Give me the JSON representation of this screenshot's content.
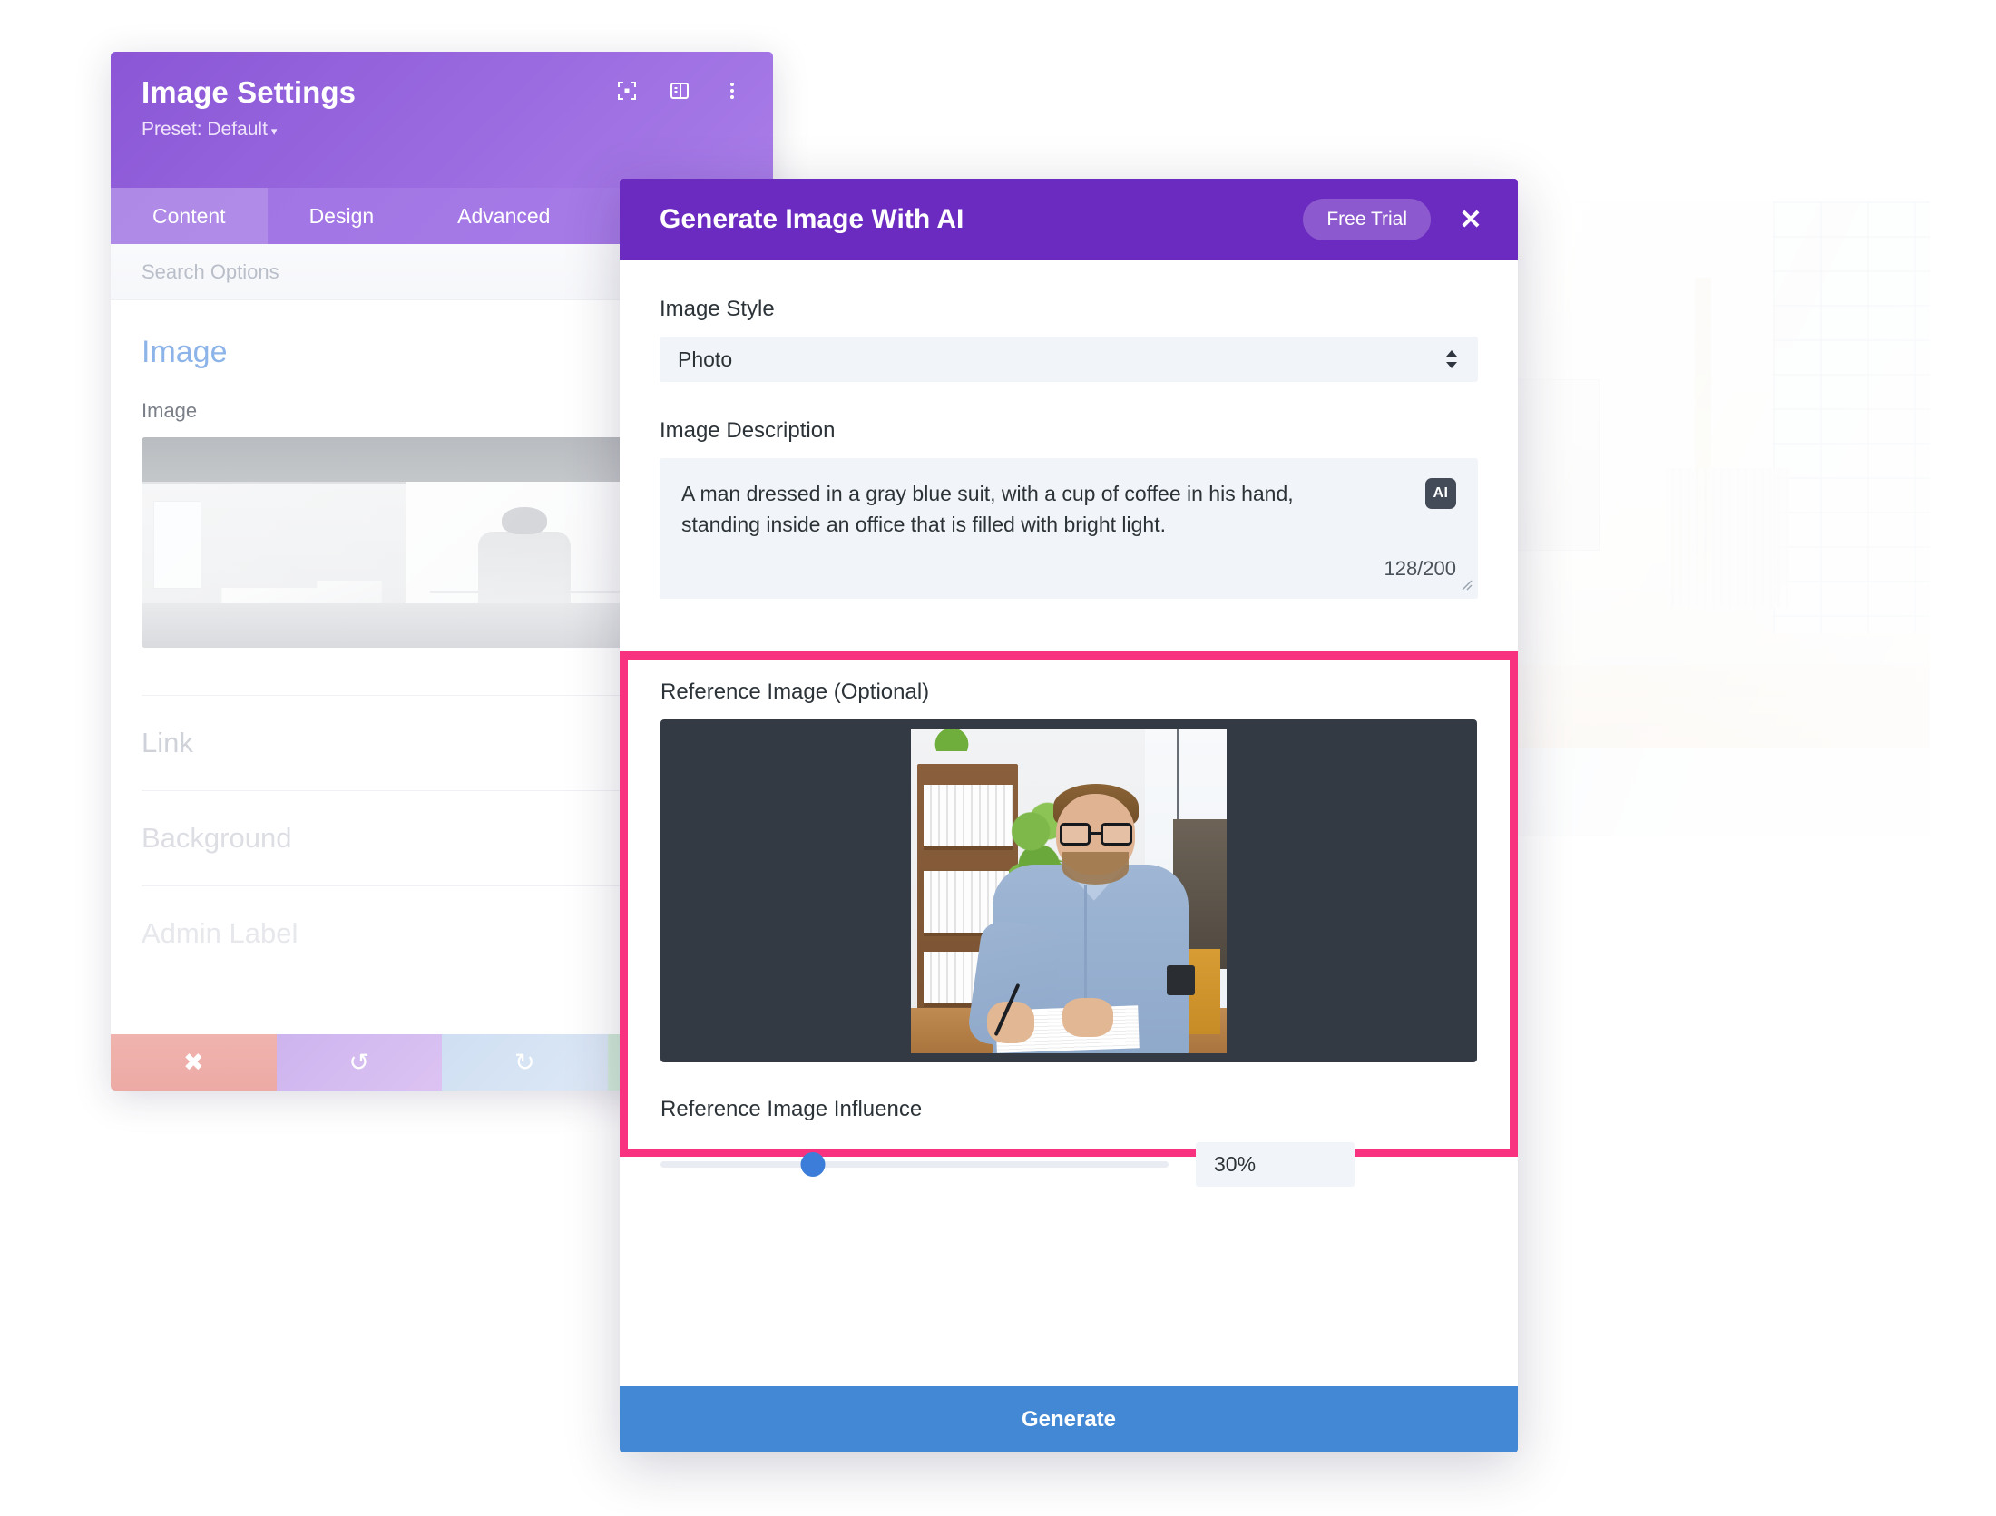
{
  "settings_panel": {
    "title": "Image Settings",
    "preset": "Preset: Default",
    "preset_caret": "▾",
    "header_icons": [
      "focus-icon",
      "layout-icon",
      "more-options-icon"
    ],
    "tabs": [
      {
        "label": "Content",
        "active": true
      },
      {
        "label": "Design",
        "active": false
      },
      {
        "label": "Advanced",
        "active": false
      }
    ],
    "search_placeholder": "Search Options",
    "section_title": "Image",
    "image_field_label": "Image",
    "collapsed_sections": [
      "Link",
      "Background",
      "Admin Label"
    ],
    "footer_buttons": [
      {
        "name": "cancel-button",
        "glyph": "✖"
      },
      {
        "name": "undo-button",
        "glyph": "↺"
      },
      {
        "name": "redo-button",
        "glyph": "↻"
      },
      {
        "name": "save-button",
        "glyph": "✔"
      }
    ]
  },
  "ai_modal": {
    "title": "Generate Image With AI",
    "free_trial_label": "Free Trial",
    "close_glyph": "✕",
    "image_style": {
      "label": "Image Style",
      "value": "Photo"
    },
    "image_description": {
      "label": "Image Description",
      "value": "A man dressed in a gray blue suit, with a cup of coffee in his hand, standing inside an office that is filled with bright light.",
      "badge": "AI",
      "counter": "128/200",
      "char_count": 128,
      "char_limit": 200
    },
    "reference_image": {
      "label": "Reference Image (Optional)",
      "highlight_color": "#f9327f"
    },
    "reference_influence": {
      "label": "Reference Image Influence",
      "value": "30%",
      "percent": 30
    },
    "generate_label": "Generate",
    "accent_color": "#6c2bc0",
    "generate_color": "#4288d4"
  }
}
